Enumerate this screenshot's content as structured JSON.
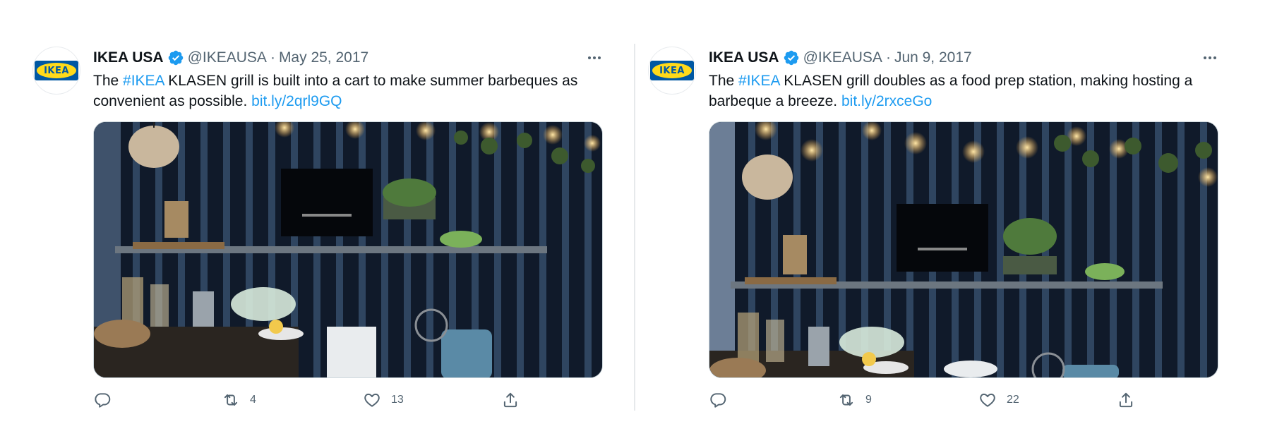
{
  "tweets": [
    {
      "author": {
        "name": "IKEA USA",
        "handle": "@IKEAUSA",
        "logo_text": "IKEA"
      },
      "separator": "·",
      "date": "May 25, 2017",
      "text": {
        "before": "The ",
        "hashtag": "#IKEA",
        "after": " KLASEN grill is built into a cart to make summer barbeques as convenient as possible. ",
        "link": "bit.ly/2qrl9GQ"
      },
      "stats": {
        "retweets": "4",
        "likes": "13"
      }
    },
    {
      "author": {
        "name": "IKEA USA",
        "handle": "@IKEAUSA",
        "logo_text": "IKEA"
      },
      "separator": "·",
      "date": "Jun 9, 2017",
      "text": {
        "before": "The ",
        "hashtag": "#IKEA",
        "after": " KLASEN grill doubles as a food prep station, making hosting a barbeque a breeze. ",
        "link": "bit.ly/2rxceGo"
      },
      "stats": {
        "retweets": "9",
        "likes": "22"
      }
    }
  ],
  "icons": {
    "verified": "verified-badge-icon",
    "more": "more-horizontal-icon",
    "reply": "reply-icon",
    "retweet": "retweet-icon",
    "like": "heart-icon",
    "share": "share-icon"
  },
  "colors": {
    "accent": "#1d9bf0",
    "secondary_text": "#536471",
    "ikea_blue": "#0058a3",
    "ikea_yellow": "#ffda1a"
  }
}
